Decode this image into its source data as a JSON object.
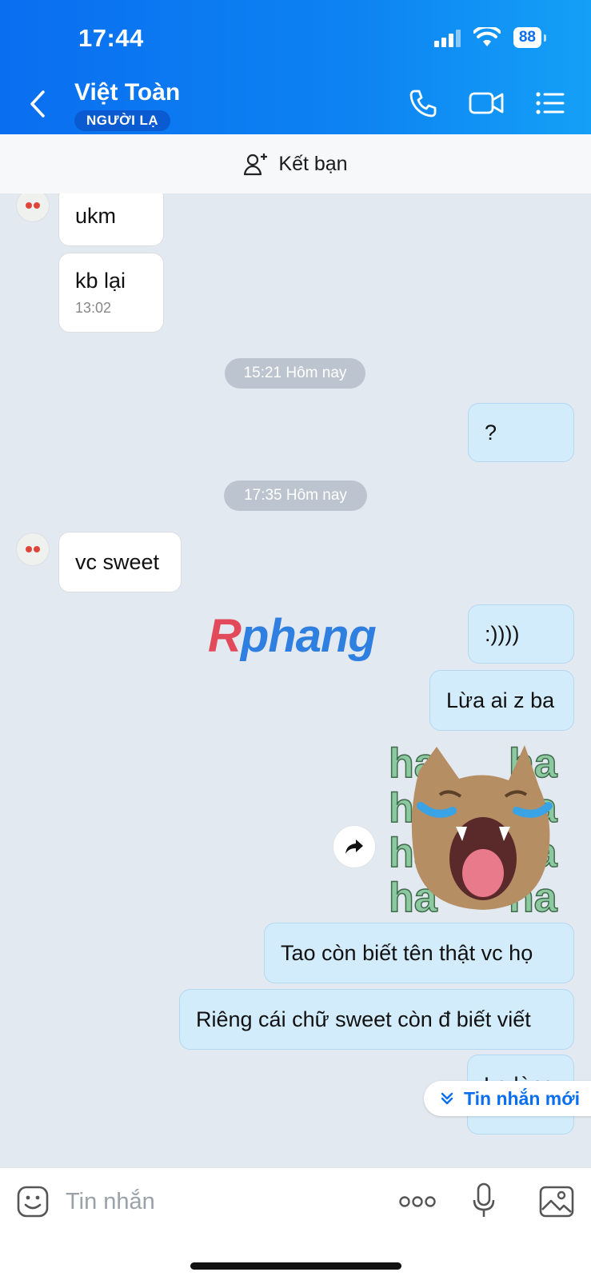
{
  "status": {
    "time": "17:44",
    "battery": "88"
  },
  "header": {
    "name": "Việt Toàn",
    "badge": "NGƯỜI LẠ"
  },
  "add_friend": {
    "label": "Kết bạn"
  },
  "watermark": "Rphang",
  "messages": [
    {
      "text": "ukm"
    },
    {
      "text": "kb lại",
      "time": "13:02"
    },
    {
      "date": "15:21 Hôm nay"
    },
    {
      "text": "?"
    },
    {
      "date": "17:35 Hôm nay"
    },
    {
      "text": "vc sweet"
    },
    {
      "text": ":))))"
    },
    {
      "text": "Lừa ai z ba"
    },
    {
      "sticker": "ha"
    },
    {
      "text": "Tao còn biết tên thật vc họ"
    },
    {
      "text": "Riêng cái chữ sweet còn đ biết viết"
    },
    {
      "text": "Lạ lùng"
    }
  ],
  "new_message_label": "Tin nhắn mới",
  "input": {
    "placeholder": "Tin nhắn"
  },
  "colors": {
    "header": "#0a6ef0",
    "outgoing_bubble": "#d3ecfb",
    "incoming_bubble": "#ffffff",
    "background": "#e3e9f0"
  }
}
